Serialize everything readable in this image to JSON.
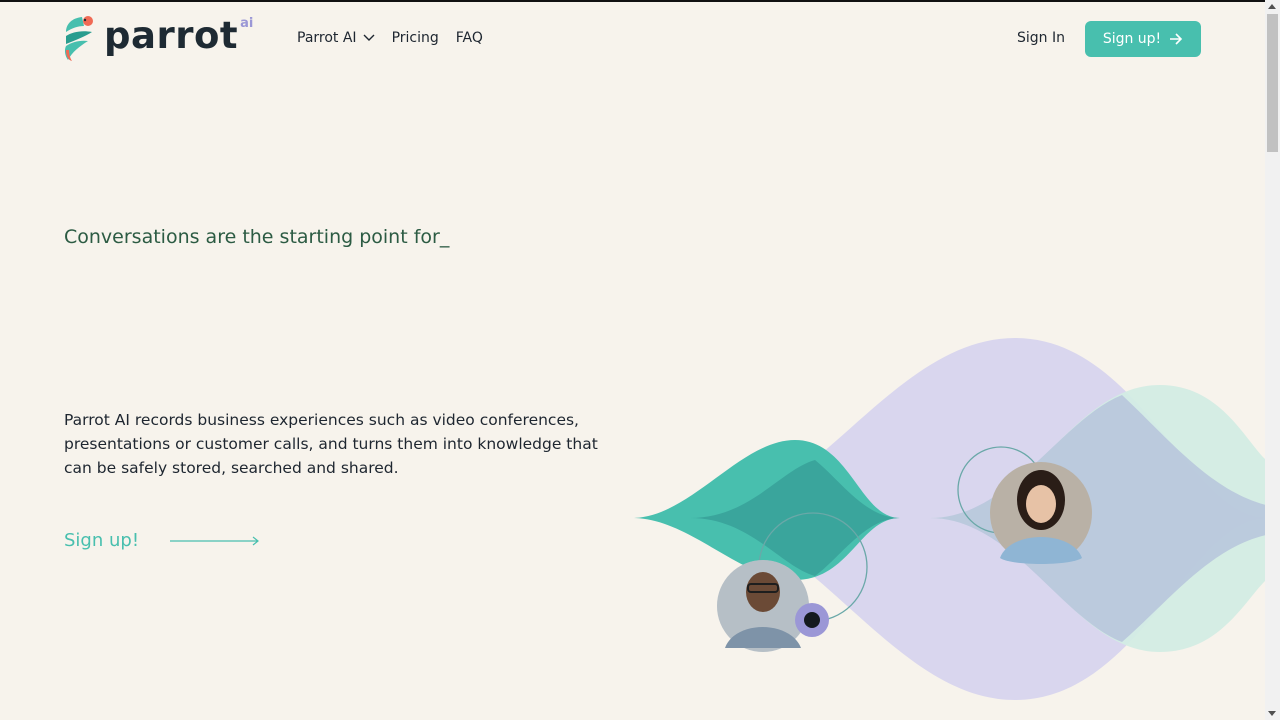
{
  "brand": {
    "name": "parrot",
    "suffix": "ai"
  },
  "nav": {
    "items": [
      {
        "label": "Parrot AI",
        "has_dropdown": true
      },
      {
        "label": "Pricing"
      },
      {
        "label": "FAQ"
      }
    ],
    "signin_label": "Sign In",
    "signup_label": "Sign up!"
  },
  "hero": {
    "tagline": "Conversations are the starting point for_",
    "description": "Parrot AI records business experiences such as video conferences, presentations or customer calls, and turns them into knowledge that can be safely stored, searched and shared.",
    "cta_label": "Sign up!"
  },
  "colors": {
    "background": "#f7f3ec",
    "accent": "#48bfae",
    "lavender": "#d9d6ee",
    "mint": "#d3ece4",
    "text_dark": "#1e2630",
    "tagline_green": "#2c5b43"
  }
}
